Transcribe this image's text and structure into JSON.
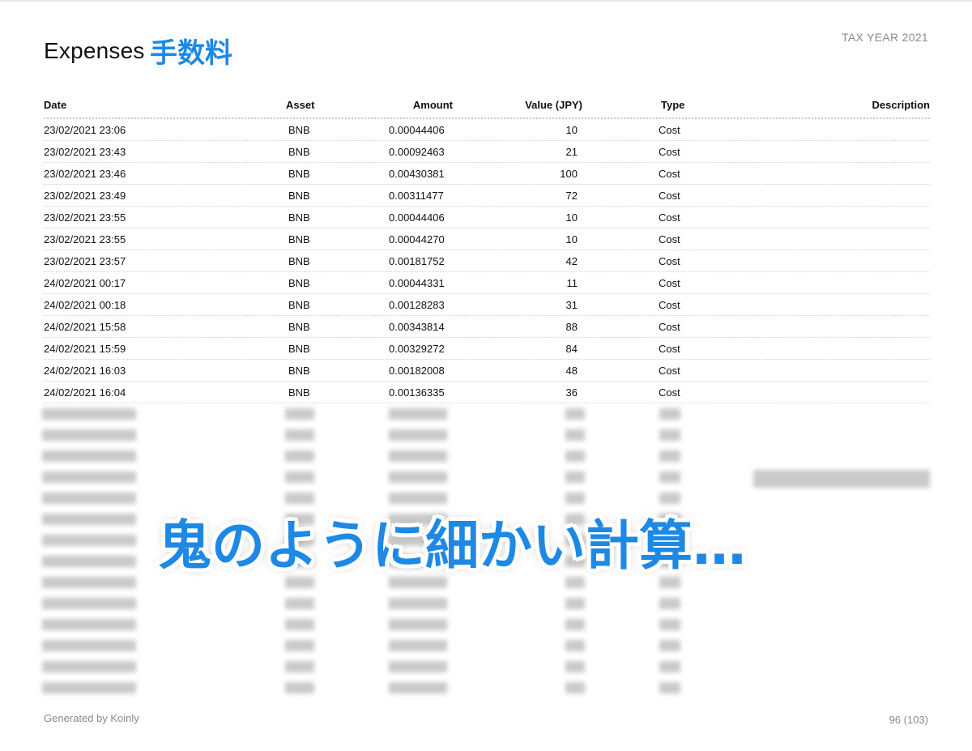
{
  "header": {
    "title": "Expenses",
    "title_jp": "手数料",
    "tax_year": "TAX YEAR 2021"
  },
  "table": {
    "columns": {
      "date": "Date",
      "asset": "Asset",
      "amount": "Amount",
      "value": "Value (JPY)",
      "type": "Type",
      "description": "Description"
    },
    "rows": [
      {
        "date": "23/02/2021 23:06",
        "asset": "BNB",
        "amount": "0.00044406",
        "value": "10",
        "type": "Cost"
      },
      {
        "date": "23/02/2021 23:43",
        "asset": "BNB",
        "amount": "0.00092463",
        "value": "21",
        "type": "Cost"
      },
      {
        "date": "23/02/2021 23:46",
        "asset": "BNB",
        "amount": "0.00430381",
        "value": "100",
        "type": "Cost"
      },
      {
        "date": "23/02/2021 23:49",
        "asset": "BNB",
        "amount": "0.00311477",
        "value": "72",
        "type": "Cost"
      },
      {
        "date": "23/02/2021 23:55",
        "asset": "BNB",
        "amount": "0.00044406",
        "value": "10",
        "type": "Cost"
      },
      {
        "date": "23/02/2021 23:55",
        "asset": "BNB",
        "amount": "0.00044270",
        "value": "10",
        "type": "Cost"
      },
      {
        "date": "23/02/2021 23:57",
        "asset": "BNB",
        "amount": "0.00181752",
        "value": "42",
        "type": "Cost"
      },
      {
        "date": "24/02/2021 00:17",
        "asset": "BNB",
        "amount": "0.00044331",
        "value": "11",
        "type": "Cost"
      },
      {
        "date": "24/02/2021 00:18",
        "asset": "BNB",
        "amount": "0.00128283",
        "value": "31",
        "type": "Cost"
      },
      {
        "date": "24/02/2021 15:58",
        "asset": "BNB",
        "amount": "0.00343814",
        "value": "88",
        "type": "Cost"
      },
      {
        "date": "24/02/2021 15:59",
        "asset": "BNB",
        "amount": "0.00329272",
        "value": "84",
        "type": "Cost"
      },
      {
        "date": "24/02/2021 16:03",
        "asset": "BNB",
        "amount": "0.00182008",
        "value": "48",
        "type": "Cost"
      },
      {
        "date": "24/02/2021 16:04",
        "asset": "BNB",
        "amount": "0.00136335",
        "value": "36",
        "type": "Cost"
      }
    ]
  },
  "overlay": {
    "caption": "鬼のように細かい計算…"
  },
  "footer": {
    "generated_by": "Generated by Koinly",
    "page": "96 (103)"
  },
  "colors": {
    "accent": "#1e88e5",
    "muted": "#8a8a8a"
  }
}
